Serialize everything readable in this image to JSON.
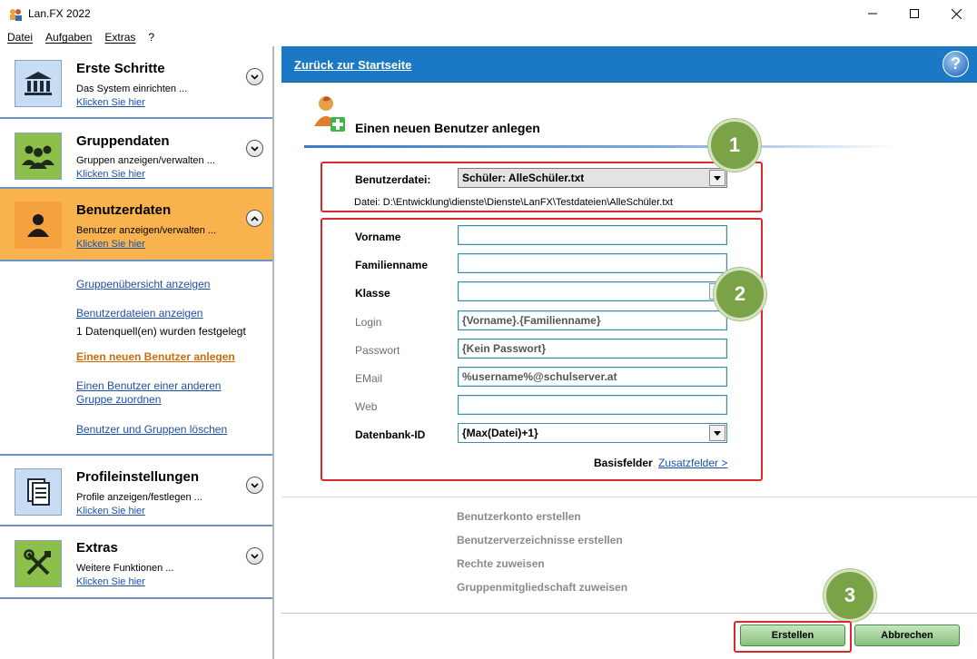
{
  "window": {
    "title": "Lan.FX 2022"
  },
  "menu": {
    "items": [
      "Datei",
      "Aufgaben",
      "Extras",
      "?"
    ]
  },
  "sidebar": {
    "sections": [
      {
        "title": "Erste Schritte",
        "desc": "Das System einrichten ...",
        "link": "Klicken Sie hier",
        "icon": "bank-icon"
      },
      {
        "title": "Gruppendaten",
        "desc": "Gruppen anzeigen/verwalten ...",
        "link": "Klicken Sie hier",
        "icon": "group-icon"
      },
      {
        "title": "Benutzerdaten",
        "desc": "Benutzer anzeigen/verwalten ...",
        "link": "Klicken Sie hier",
        "icon": "user-icon"
      },
      {
        "title": "Profileinstellungen",
        "desc": "Profile anzeigen/festlegen ...",
        "link": "Klicken Sie hier",
        "icon": "document-icon"
      },
      {
        "title": "Extras",
        "desc": "Weitere Funktionen ...",
        "link": "Klicken Sie hier",
        "icon": "tools-icon"
      }
    ],
    "sub": {
      "gruppenuebersicht": "Gruppenübersicht anzeigen",
      "benutzerdateien": "Benutzerdateien anzeigen",
      "datenquellen": "1 Datenquell(en) wurden festgelegt",
      "neuer_benutzer": "Einen neuen Benutzer anlegen",
      "zuordnen_1": "Einen Benutzer einer anderen",
      "zuordnen_2": "Gruppe zuordnen",
      "loeschen": "Benutzer und Gruppen löschen"
    }
  },
  "main": {
    "back_link": "Zurück zur Startseite",
    "help": "?",
    "title": "Einen neuen Benutzer anlegen",
    "badges": [
      "1",
      "2",
      "3"
    ],
    "benutzerdatei_label": "Benutzerdatei:",
    "benutzerdatei_value": "Schüler: AlleSchüler.txt",
    "datei_path": "Datei: D:\\Entwicklung\\dienste\\Dienste\\LanFX\\Testdateien\\AlleSchüler.txt",
    "fields": {
      "vorname": {
        "label": "Vorname",
        "value": ""
      },
      "familienname": {
        "label": "Familienname",
        "value": ""
      },
      "klasse": {
        "label": "Klasse",
        "value": ""
      },
      "login": {
        "label": "Login",
        "value": "{Vorname}.{Familienname}"
      },
      "passwort": {
        "label": "Passwort",
        "value": "{Kein Passwort}"
      },
      "email": {
        "label": "EMail",
        "value": "%username%@schulserver.at"
      },
      "web": {
        "label": "Web",
        "value": ""
      },
      "datenbank": {
        "label": "Datenbank-ID",
        "value": "{Max(Datei)+1}"
      }
    },
    "basisfelder": "Basisfelder",
    "zusatzfelder": "Zusatzfelder >",
    "steps": [
      "Benutzerkonto erstellen",
      "Benutzerverzeichnisse erstellen",
      "Rechte zuweisen",
      "Gruppenmitgliedschaft zuweisen"
    ],
    "buttons": {
      "create": "Erstellen",
      "cancel": "Abbrechen"
    }
  }
}
